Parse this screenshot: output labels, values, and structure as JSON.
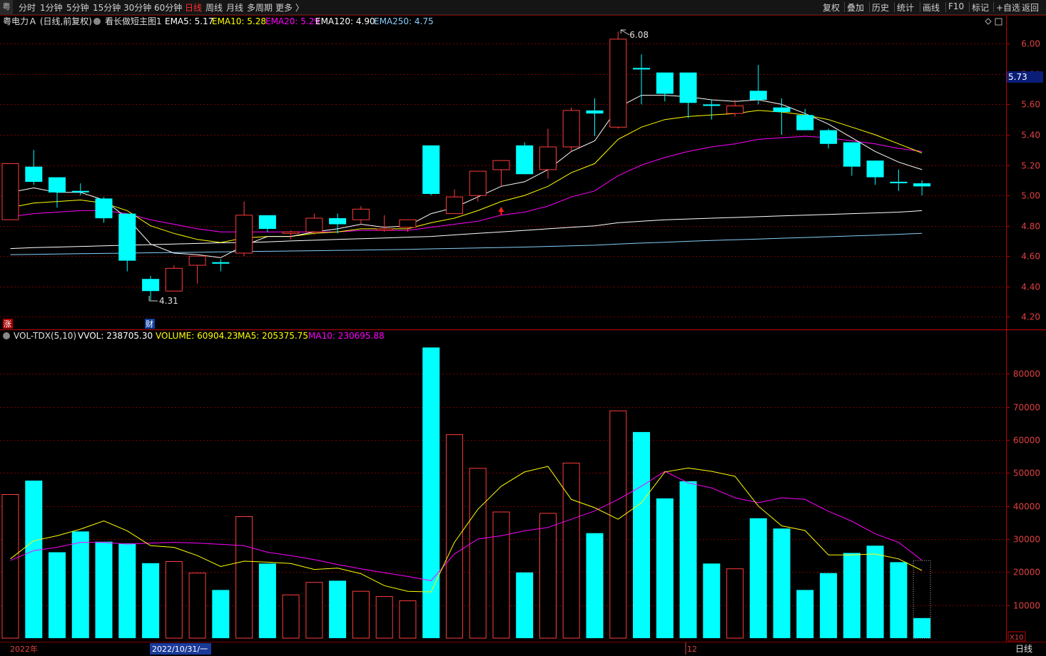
{
  "toolbar": {
    "badge": "粤",
    "left": [
      "分时",
      "1分钟",
      "5分钟",
      "15分钟",
      "30分钟",
      "60分钟",
      "日线",
      "周线",
      "月线",
      "多周期",
      "更多 〉"
    ],
    "active": "日线",
    "right": [
      "复权",
      "叠加",
      "历史",
      "统计",
      "画线",
      "F10",
      "标记",
      "+自选",
      "返回"
    ]
  },
  "price_header": {
    "title": "粤电力Ａ (日线,前复权)",
    "indicator": "看长做短主图1",
    "items": [
      {
        "label": "EMA5: 5.17",
        "color": "#ffffff"
      },
      {
        "label": "EMA10: 5.28",
        "color": "#ffff00"
      },
      {
        "label": "EMA20: 5.29",
        "color": "#ff00ff"
      },
      {
        "label": "EMA120: 4.90",
        "color": "#ffffff"
      },
      {
        "label": "EMA250: 4.75",
        "color": "#87cefa"
      }
    ]
  },
  "vol_header": {
    "title": "VOL-TDX(5,10)",
    "items": [
      {
        "label": "VVOL: 238705.30",
        "color": "#ffffff"
      },
      {
        "label": "VOLUME: 60904.23",
        "color": "#ffff00"
      },
      {
        "label": "MA5: 205375.75",
        "color": "#ffff00"
      },
      {
        "label": "MA10: 230695.88",
        "color": "#ff00ff"
      }
    ]
  },
  "markers": {
    "zhang": "涨",
    "cai": "财",
    "high": "6.08",
    "low": "4.31"
  },
  "bottom": {
    "year": "2022年",
    "date": "2022/10/31/一",
    "month": "12",
    "period": "日线",
    "x10": "X10"
  },
  "price_tag": "5.73",
  "colors": {
    "up": "#ff3c3c",
    "down": "#00ffff",
    "grid": "#7a0000",
    "ema5": "#ffffff",
    "ema10": "#ffff00",
    "ema20": "#ff00ff",
    "ema120": "#ffffff",
    "ema250": "#87cefa"
  },
  "chart_data": [
    {
      "type": "candlestick",
      "ylim": [
        4.15,
        6.1
      ],
      "yticks": [
        4.2,
        4.4,
        4.6,
        4.8,
        5.0,
        5.2,
        5.4,
        5.6,
        5.8,
        6.0
      ],
      "candles": [
        {
          "o": 4.84,
          "h": 5.21,
          "l": 4.84,
          "c": 5.21
        },
        {
          "o": 5.19,
          "h": 5.3,
          "l": 5.07,
          "c": 5.09
        },
        {
          "o": 5.12,
          "h": 5.12,
          "l": 4.92,
          "c": 5.02
        },
        {
          "o": 5.03,
          "h": 5.08,
          "l": 5.0,
          "c": 5.02
        },
        {
          "o": 4.98,
          "h": 4.99,
          "l": 4.82,
          "c": 4.85
        },
        {
          "o": 4.88,
          "h": 4.88,
          "l": 4.5,
          "c": 4.57
        },
        {
          "o": 4.45,
          "h": 4.47,
          "l": 4.31,
          "c": 4.37
        },
        {
          "o": 4.37,
          "h": 4.54,
          "l": 4.37,
          "c": 4.52
        },
        {
          "o": 4.54,
          "h": 4.59,
          "l": 4.42,
          "c": 4.6
        },
        {
          "o": 4.56,
          "h": 4.58,
          "l": 4.5,
          "c": 4.55
        },
        {
          "o": 4.62,
          "h": 4.96,
          "l": 4.6,
          "c": 4.87
        },
        {
          "o": 4.87,
          "h": 4.87,
          "l": 4.76,
          "c": 4.78
        },
        {
          "o": 4.75,
          "h": 4.77,
          "l": 4.71,
          "c": 4.76
        },
        {
          "o": 4.76,
          "h": 4.88,
          "l": 4.74,
          "c": 4.85
        },
        {
          "o": 4.85,
          "h": 4.88,
          "l": 4.75,
          "c": 4.81
        },
        {
          "o": 4.84,
          "h": 4.93,
          "l": 4.81,
          "c": 4.91
        },
        {
          "o": 4.78,
          "h": 4.87,
          "l": 4.76,
          "c": 4.78
        },
        {
          "o": 4.79,
          "h": 4.84,
          "l": 4.76,
          "c": 4.84
        },
        {
          "o": 5.33,
          "h": 5.33,
          "l": 5.0,
          "c": 5.01
        },
        {
          "o": 4.88,
          "h": 5.04,
          "l": 4.88,
          "c": 4.99
        },
        {
          "o": 5.0,
          "h": 5.16,
          "l": 4.96,
          "c": 5.16
        },
        {
          "o": 5.17,
          "h": 5.22,
          "l": 5.06,
          "c": 5.23
        },
        {
          "o": 5.33,
          "h": 5.35,
          "l": 5.14,
          "c": 5.14
        },
        {
          "o": 5.17,
          "h": 5.44,
          "l": 5.11,
          "c": 5.32
        },
        {
          "o": 5.32,
          "h": 5.58,
          "l": 5.29,
          "c": 5.56
        },
        {
          "o": 5.56,
          "h": 5.64,
          "l": 5.39,
          "c": 5.54
        },
        {
          "o": 5.45,
          "h": 6.08,
          "l": 5.44,
          "c": 6.03
        },
        {
          "o": 5.84,
          "h": 5.93,
          "l": 5.6,
          "c": 5.83
        },
        {
          "o": 5.81,
          "h": 5.81,
          "l": 5.62,
          "c": 5.67
        },
        {
          "o": 5.81,
          "h": 5.81,
          "l": 5.51,
          "c": 5.61
        },
        {
          "o": 5.6,
          "h": 5.63,
          "l": 5.5,
          "c": 5.59
        },
        {
          "o": 5.54,
          "h": 5.63,
          "l": 5.52,
          "c": 5.59
        },
        {
          "o": 5.69,
          "h": 5.86,
          "l": 5.6,
          "c": 5.63
        },
        {
          "o": 5.58,
          "h": 5.64,
          "l": 5.4,
          "c": 5.55
        },
        {
          "o": 5.53,
          "h": 5.57,
          "l": 5.43,
          "c": 5.43
        },
        {
          "o": 5.43,
          "h": 5.44,
          "l": 5.31,
          "c": 5.34
        },
        {
          "o": 5.35,
          "h": 5.35,
          "l": 5.13,
          "c": 5.19
        },
        {
          "o": 5.23,
          "h": 5.23,
          "l": 5.07,
          "c": 5.12
        },
        {
          "o": 5.09,
          "h": 5.17,
          "l": 5.03,
          "c": 5.08
        },
        {
          "o": 5.08,
          "h": 5.1,
          "l": 5.0,
          "c": 5.06
        }
      ],
      "ema5": [
        5.02,
        5.05,
        5.02,
        5.02,
        4.97,
        4.85,
        4.68,
        4.62,
        4.61,
        4.59,
        4.67,
        4.73,
        4.73,
        4.76,
        4.78,
        4.81,
        4.79,
        4.8,
        4.88,
        4.92,
        4.99,
        5.06,
        5.09,
        5.17,
        5.29,
        5.36,
        5.58,
        5.66,
        5.66,
        5.65,
        5.63,
        5.62,
        5.63,
        5.6,
        5.54,
        5.47,
        5.38,
        5.29,
        5.22,
        5.17
      ],
      "ema10": [
        4.92,
        4.95,
        4.96,
        4.97,
        4.95,
        4.9,
        4.8,
        4.75,
        4.71,
        4.69,
        4.72,
        4.73,
        4.73,
        4.75,
        4.76,
        4.78,
        4.78,
        4.78,
        4.82,
        4.85,
        4.9,
        4.96,
        5.0,
        5.06,
        5.15,
        5.21,
        5.37,
        5.45,
        5.5,
        5.52,
        5.53,
        5.54,
        5.56,
        5.55,
        5.53,
        5.5,
        5.45,
        5.4,
        5.34,
        5.28
      ],
      "ema20": [
        4.86,
        4.88,
        4.89,
        4.9,
        4.9,
        4.88,
        4.84,
        4.81,
        4.78,
        4.76,
        4.76,
        4.76,
        4.76,
        4.76,
        4.76,
        4.77,
        4.77,
        4.77,
        4.79,
        4.81,
        4.83,
        4.87,
        4.89,
        4.93,
        4.99,
        5.03,
        5.13,
        5.2,
        5.25,
        5.29,
        5.32,
        5.34,
        5.37,
        5.38,
        5.39,
        5.38,
        5.36,
        5.34,
        5.31,
        5.29
      ],
      "ema120": [
        4.65,
        4.656,
        4.66,
        4.664,
        4.668,
        4.672,
        4.676,
        4.68,
        4.684,
        4.688,
        4.69,
        4.694,
        4.7,
        4.705,
        4.71,
        4.715,
        4.72,
        4.725,
        4.73,
        4.74,
        4.75,
        4.76,
        4.77,
        4.78,
        4.79,
        4.8,
        4.82,
        4.83,
        4.84,
        4.845,
        4.85,
        4.855,
        4.86,
        4.865,
        4.87,
        4.875,
        4.88,
        4.885,
        4.89,
        4.9
      ],
      "ema250": [
        4.61,
        4.612,
        4.614,
        4.616,
        4.618,
        4.62,
        4.622,
        4.624,
        4.626,
        4.628,
        4.63,
        4.632,
        4.634,
        4.636,
        4.638,
        4.64,
        4.642,
        4.645,
        4.648,
        4.651,
        4.654,
        4.657,
        4.66,
        4.664,
        4.668,
        4.672,
        4.68,
        4.686,
        4.692,
        4.698,
        4.703,
        4.708,
        4.713,
        4.718,
        4.723,
        4.728,
        4.733,
        4.738,
        4.744,
        4.75
      ]
    },
    {
      "type": "bar",
      "ylim": [
        0,
        90000
      ],
      "yticks": [
        10000,
        20000,
        30000,
        40000,
        50000,
        60000,
        70000,
        80000
      ],
      "volume": [
        43500,
        47700,
        26000,
        32300,
        29200,
        28700,
        22700,
        23200,
        19700,
        14600,
        36800,
        22600,
        13100,
        16900,
        17400,
        14200,
        12600,
        11300,
        88000,
        61600,
        51400,
        38200,
        19900,
        37800,
        53000,
        31800,
        68800,
        62400,
        42300,
        47500,
        22600,
        21000,
        36300,
        33200,
        14600,
        19700,
        25800,
        28000,
        23000,
        6090
      ],
      "ma5": [
        24000,
        29500,
        31000,
        33000,
        35500,
        32500,
        28000,
        27500,
        25000,
        21700,
        23300,
        23000,
        22600,
        20800,
        21200,
        19500,
        15900,
        14200,
        14000,
        29000,
        39000,
        46000,
        50300,
        52000,
        42000,
        39500,
        36000,
        41000,
        50300,
        51500,
        50500,
        49000,
        40000,
        34000,
        32600,
        25200,
        25200,
        25500,
        24000,
        20500
      ],
      "ma10": [
        23500,
        26500,
        27500,
        29000,
        29000,
        28500,
        28800,
        29000,
        28800,
        28400,
        28000,
        26000,
        25000,
        23800,
        22300,
        21000,
        19800,
        18700,
        17400,
        25500,
        30000,
        31000,
        32500,
        33500,
        36000,
        38500,
        42000,
        46000,
        50500,
        47000,
        45500,
        42500,
        41000,
        42500,
        42000,
        38400,
        35400,
        31600,
        29000,
        23600
      ]
    }
  ]
}
